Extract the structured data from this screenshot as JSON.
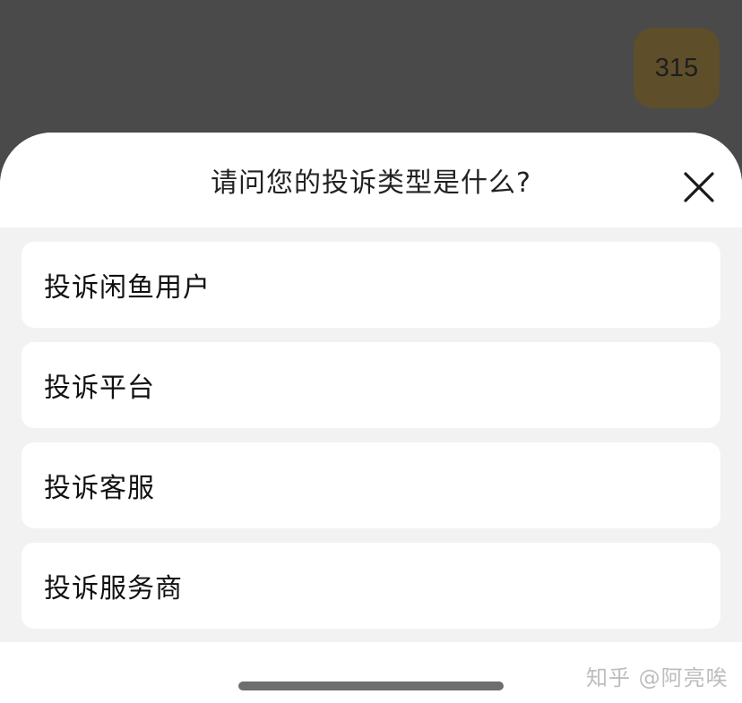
{
  "background": {
    "badge_text": "315"
  },
  "sheet": {
    "title": "请问您的投诉类型是什么?",
    "close_icon": "close-icon",
    "options": [
      {
        "label": "投诉闲鱼用户"
      },
      {
        "label": "投诉平台"
      },
      {
        "label": "投诉客服"
      },
      {
        "label": "投诉服务商"
      }
    ]
  },
  "watermark": "知乎 @阿亮唉",
  "colors": {
    "overlay": "#4a4a4a",
    "badge": "#5e4f2a",
    "sheet_bg": "#ffffff",
    "list_bg": "#f2f2f2"
  }
}
